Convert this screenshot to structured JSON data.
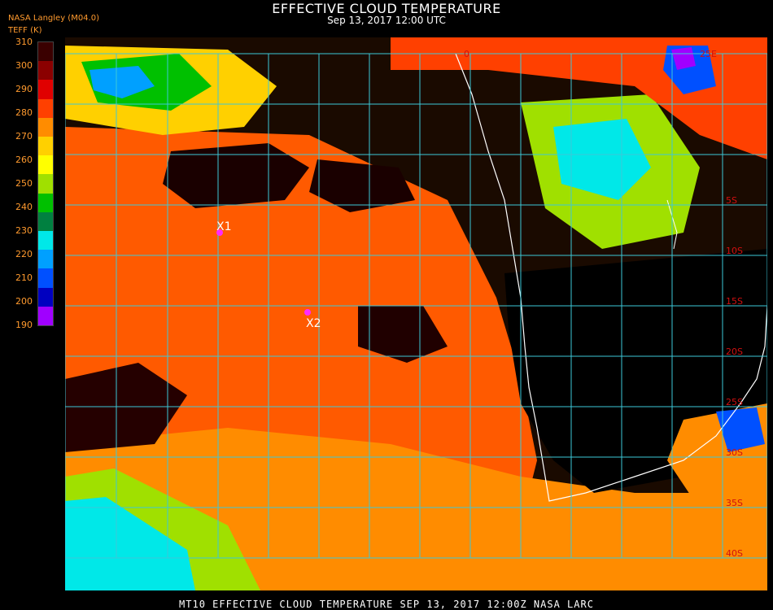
{
  "header": {
    "title": "EFFECTIVE CLOUD TEMPERATURE",
    "subtitle": "Sep 13, 2017 12:00 UTC",
    "org": "NASA Langley (M04.0)",
    "unit": "TEFF (K)"
  },
  "legend": {
    "ticks": [
      310,
      300,
      290,
      280,
      270,
      260,
      250,
      240,
      230,
      220,
      210,
      200,
      190
    ],
    "colors": [
      "#3a0000",
      "#8b0000",
      "#e00000",
      "#ff4000",
      "#ff8c00",
      "#ffd000",
      "#ffff00",
      "#a0e000",
      "#00c000",
      "#008040",
      "#00e8e8",
      "#00a0ff",
      "#0050ff",
      "#0000c0",
      "#a000ff"
    ]
  },
  "map": {
    "lat_labels": [
      "5S",
      "10S",
      "15S",
      "20S",
      "25S",
      "30S",
      "35S",
      "40S"
    ],
    "top_labels": [
      "0",
      "25E"
    ],
    "markers": [
      {
        "label": "X1"
      },
      {
        "label": "X2"
      }
    ],
    "colors": {
      "grid": "#3cc8d8",
      "coast": "#ffffff",
      "marker": "#ff2aff",
      "lat_label": "#d01010"
    }
  },
  "footer": {
    "text": "MT10  EFFECTIVE CLOUD TEMPERATURE   SEP 13, 2017 12:00Z   NASA LARC"
  }
}
